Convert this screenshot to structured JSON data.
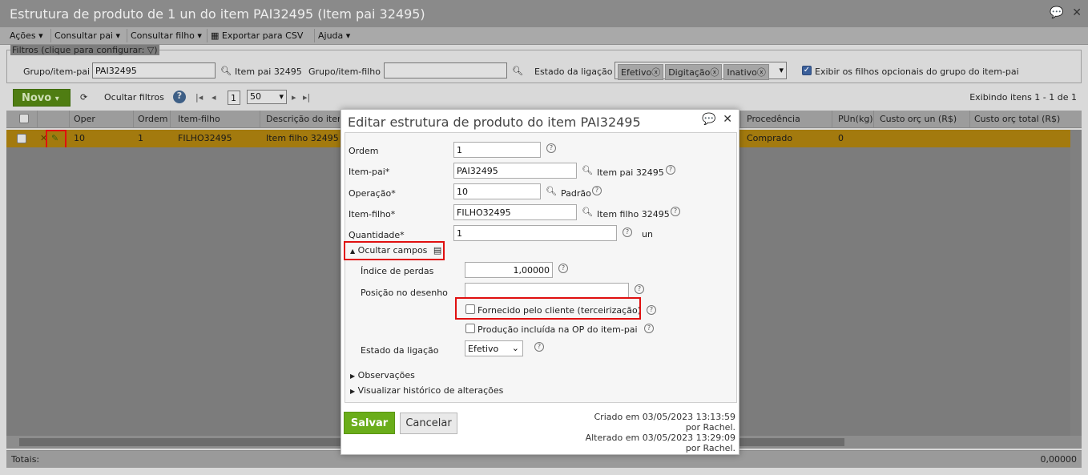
{
  "window": {
    "title": "Estrutura de produto de 1 un do item PAI32495 (Item pai 32495)"
  },
  "menubar": {
    "acoes": "Ações",
    "consultar_pai": "Consultar pai",
    "consultar_filho": "Consultar filho",
    "exportar_csv": "Exportar para CSV",
    "ajuda": "Ajuda"
  },
  "filters": {
    "legend": "Filtros (clique para configurar:",
    "grupo_item_pai_label": "Grupo/item-pai",
    "grupo_item_pai_value": "PAI32495",
    "item_pai_desc": "Item pai 32495",
    "grupo_item_filho_label": "Grupo/item-filho",
    "grupo_item_filho_value": "",
    "estado_ligacao_label": "Estado da ligação",
    "estado_tags": [
      "Efetivo",
      "Digitação",
      "Inativo"
    ],
    "exibir_filhos_label": "Exibir os filhos opcionais do grupo do item-pai",
    "exibir_filhos_checked": true
  },
  "toolbar": {
    "novo": "Novo",
    "ocultar_filtros": "Ocultar filtros",
    "page": "1",
    "page_size": "50",
    "exibindo": "Exibindo itens 1 - 1 de 1"
  },
  "grid": {
    "columns": [
      "Oper",
      "Ordem",
      "Item-filho",
      "Descrição do item",
      "Procedência",
      "PUn(kg)",
      "Custo orç un (R$)",
      "Custo orç total (R$)"
    ],
    "row": {
      "oper": "10",
      "ordem": "1",
      "item_filho": "FILHO32495",
      "descricao": "Item filho 32495",
      "procedencia": "Comprado",
      "pun": "0"
    },
    "totais_label": "Totais:",
    "total_value": "0,00000"
  },
  "modal": {
    "title": "Editar estrutura de produto do item PAI32495",
    "ordem_label": "Ordem",
    "ordem_value": "1",
    "item_pai_label": "Item-pai*",
    "item_pai_value": "PAI32495",
    "item_pai_desc": "Item pai 32495",
    "operacao_label": "Operação*",
    "operacao_value": "10",
    "operacao_desc": "Padrão",
    "item_filho_label": "Item-filho*",
    "item_filho_value": "FILHO32495",
    "item_filho_desc": "Item filho 32495",
    "quantidade_label": "Quantidade*",
    "quantidade_value": "1",
    "quantidade_unit": "un",
    "ocultar_campos": "Ocultar campos",
    "indice_perdas_label": "Índice de perdas",
    "indice_perdas_value": "1,00000",
    "posicao_desenho_label": "Posição no desenho",
    "posicao_desenho_value": "",
    "fornecido_cliente_label": "Fornecido pelo cliente (terceirização)",
    "producao_incluida_label": "Produção incluída na OP do item-pai",
    "estado_ligacao_label": "Estado da ligação",
    "estado_ligacao_value": "Efetivo",
    "observacoes": "Observações",
    "historico": "Visualizar histórico de alterações",
    "salvar": "Salvar",
    "cancelar": "Cancelar",
    "criado_em": "Criado em 03/05/2023 13:13:59",
    "criado_por": "por Rachel.",
    "alterado_em": "Alterado em 03/05/2023 13:29:09",
    "alterado_por": "por Rachel."
  }
}
